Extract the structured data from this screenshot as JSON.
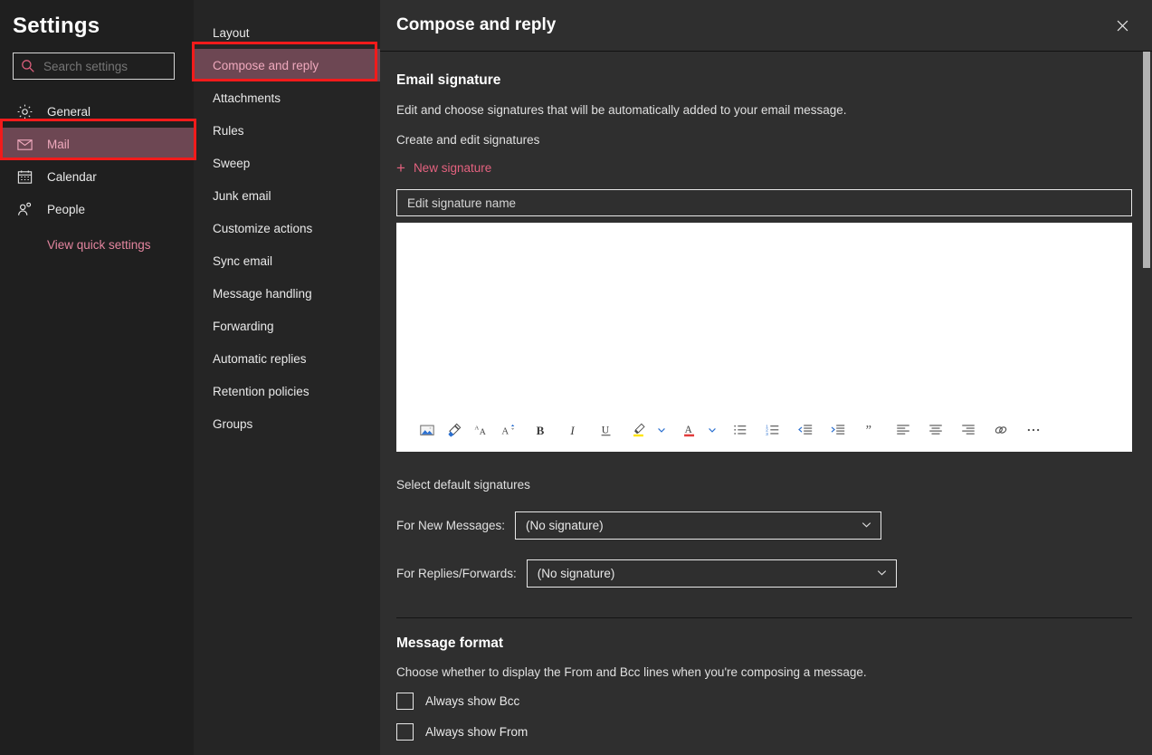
{
  "sidebar": {
    "title": "Settings",
    "search": {
      "placeholder": "Search settings",
      "icon": "search-icon"
    },
    "items": [
      {
        "label": "General",
        "icon": "gear-icon",
        "selected": false
      },
      {
        "label": "Mail",
        "icon": "envelope-icon",
        "selected": true
      },
      {
        "label": "Calendar",
        "icon": "calendar-icon",
        "selected": false
      },
      {
        "label": "People",
        "icon": "people-icon",
        "selected": false
      }
    ],
    "quick_settings_link": "View quick settings"
  },
  "midnav": {
    "items": [
      {
        "label": "Layout",
        "selected": false
      },
      {
        "label": "Compose and reply",
        "selected": true
      },
      {
        "label": "Attachments",
        "selected": false
      },
      {
        "label": "Rules",
        "selected": false
      },
      {
        "label": "Sweep",
        "selected": false
      },
      {
        "label": "Junk email",
        "selected": false
      },
      {
        "label": "Customize actions",
        "selected": false
      },
      {
        "label": "Sync email",
        "selected": false
      },
      {
        "label": "Message handling",
        "selected": false
      },
      {
        "label": "Forwarding",
        "selected": false
      },
      {
        "label": "Automatic replies",
        "selected": false
      },
      {
        "label": "Retention policies",
        "selected": false
      },
      {
        "label": "Groups",
        "selected": false
      }
    ]
  },
  "main": {
    "title": "Compose and reply",
    "close_icon": "close-icon",
    "email_signature": {
      "heading": "Email signature",
      "description": "Edit and choose signatures that will be automatically added to your email message.",
      "create_label": "Create and edit signatures",
      "new_signature_label": "New signature",
      "signature_name_placeholder": "Edit signature name",
      "signature_name_value": ""
    },
    "toolbar": {
      "items": [
        "insert-picture-icon",
        "format-painter-icon",
        "font-size-icon",
        "font-grow-icon",
        "bold-icon",
        "italic-icon",
        "underline-icon",
        "highlight-color-icon",
        "highlight-chevron-icon",
        "font-color-icon",
        "font-color-chevron-icon",
        "bulleted-list-icon",
        "numbered-list-icon",
        "decrease-indent-icon",
        "increase-indent-icon",
        "quote-icon",
        "align-left-icon",
        "align-center-icon",
        "align-right-icon",
        "insert-link-icon",
        "more-options-icon"
      ]
    },
    "defaults": {
      "heading": "Select default signatures",
      "new_messages_label": "For New Messages:",
      "new_messages_value": "(No signature)",
      "replies_label": "For Replies/Forwards:",
      "replies_value": "(No signature)",
      "options": [
        "(No signature)"
      ]
    },
    "message_format": {
      "heading": "Message format",
      "description": "Choose whether to display the From and Bcc lines when you're composing a message.",
      "checkboxes": [
        {
          "label": "Always show Bcc",
          "checked": false
        },
        {
          "label": "Always show From",
          "checked": false
        }
      ]
    }
  },
  "colors": {
    "accent_pink": "#e4627f",
    "selected_bg": "#6d4753",
    "selected_text": "#efa9bd",
    "annotation_red": "#f21b1b",
    "sidebar_bg": "#1f1f1f",
    "midnav_bg": "#252525",
    "main_bg": "#2f2f2f",
    "editor_bg": "#ffffff"
  }
}
